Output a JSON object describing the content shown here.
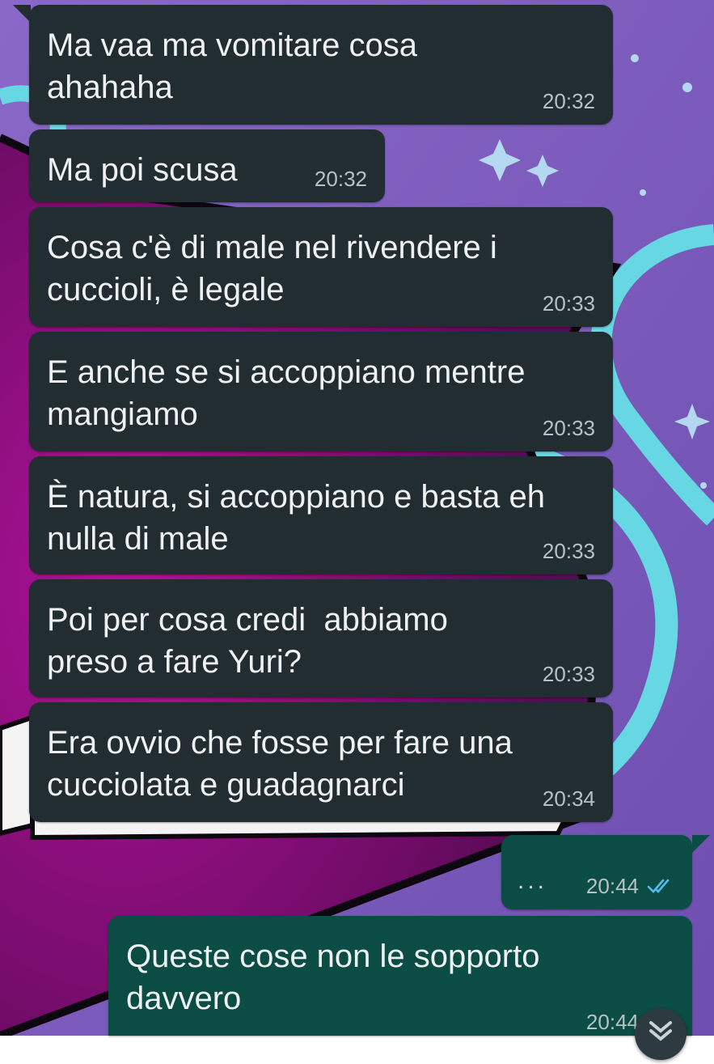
{
  "messages": [
    {
      "text": "Ma vaa ma vomitare cosa ahahaha",
      "time": "20:32",
      "direction": "in"
    },
    {
      "text": "Ma poi scusa",
      "time": "20:32",
      "direction": "in"
    },
    {
      "text": "Cosa c'è di male nel rivendere i cuccioli, è legale",
      "time": "20:33",
      "direction": "in"
    },
    {
      "text": "E anche se si accoppiano mentre mangiamo",
      "time": "20:33",
      "direction": "in"
    },
    {
      "text": "È natura, si accoppiano e basta eh nulla di male",
      "time": "20:33",
      "direction": "in"
    },
    {
      "text": "Poi per cosa credi  abbiamo preso a fare Yuri?",
      "time": "20:33",
      "direction": "in"
    },
    {
      "text": "Era ovvio che fosse per fare una cucciolata e guadagnarci",
      "time": "20:34",
      "direction": "in"
    },
    {
      "text": "...",
      "time": "20:44",
      "direction": "out",
      "status": "read"
    },
    {
      "text": "Queste cose non le sopporto davvero",
      "time": "20:44",
      "direction": "out",
      "status": "read"
    }
  ],
  "colors": {
    "incoming_bubble": "#222d31",
    "outgoing_bubble": "#0b4d44",
    "read_tick": "#53bdeb",
    "wallpaper_purple": "#7b58b6",
    "wallpaper_magenta": "#8a0a7a"
  },
  "icons": [
    "double-check-icon",
    "chevron-down-icon"
  ]
}
